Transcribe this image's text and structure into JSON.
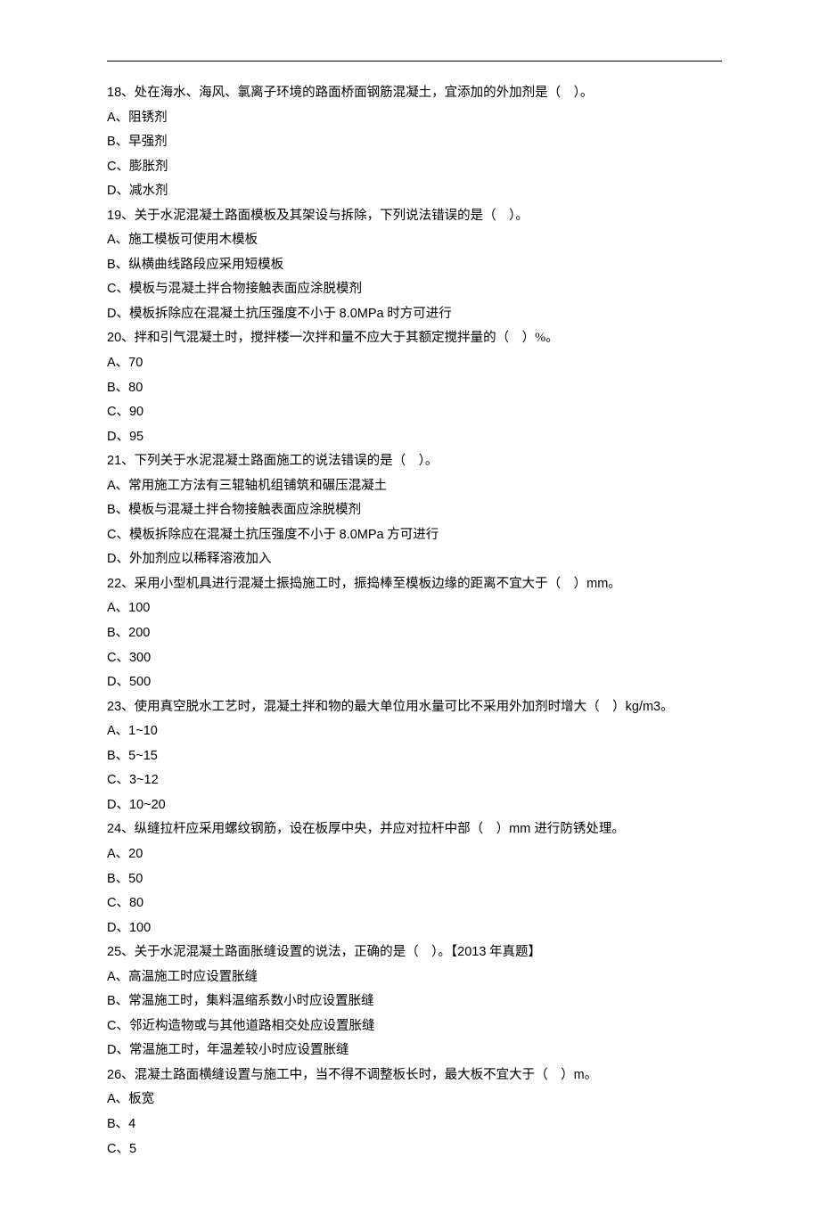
{
  "questions": [
    {
      "num": "18",
      "text": "、处在海水、海风、氯离子环境的路面桥面钢筋混凝土，宜添加的外加剂是（　）。",
      "options": [
        {
          "label": "A",
          "text": "、阻锈剂"
        },
        {
          "label": "B",
          "text": "、早强剂"
        },
        {
          "label": "C",
          "text": "、膨胀剂"
        },
        {
          "label": "D",
          "text": "、减水剂"
        }
      ]
    },
    {
      "num": "19",
      "text": "、关于水泥混凝土路面模板及其架设与拆除，下列说法错误的是（　）。",
      "options": [
        {
          "label": "A",
          "text": "、施工模板可使用木模板"
        },
        {
          "label": "B",
          "text": "、纵横曲线路段应采用短模板"
        },
        {
          "label": "C",
          "text": "、模板与混凝土拌合物接触表面应涂脱模剂"
        },
        {
          "label": "D",
          "text": "、模板拆除应在混凝土抗压强度不小于 8.0MPa 时方可进行",
          "mixed": true,
          "pre": "、模板拆除应在混凝土抗压强度不小于 ",
          "mid": "8.0MPa",
          "post": " 时方可进行"
        }
      ]
    },
    {
      "num": "20",
      "text_pre": "、拌和引气混凝土时，搅拌楼一次拌和量不应大于其额定搅拌量的（　）",
      "text_post": "%。",
      "mixed": true,
      "options": [
        {
          "label": "A",
          "text": "、",
          "num_text": "70"
        },
        {
          "label": "B",
          "text": "、",
          "num_text": "80"
        },
        {
          "label": "C",
          "text": "、",
          "num_text": "90"
        },
        {
          "label": "D",
          "text": "、",
          "num_text": "95"
        }
      ]
    },
    {
      "num": "21",
      "text": "、下列关于水泥混凝土路面施工的说法错误的是（　）。",
      "options": [
        {
          "label": "A",
          "text": "、常用施工方法有三辊轴机组铺筑和碾压混凝土"
        },
        {
          "label": "B",
          "text": "、模板与混凝土拌合物接触表面应涂脱模剂"
        },
        {
          "label": "C",
          "text": "、模板拆除应在混凝土抗压强度不小于 8.0MPa 方可进行",
          "mixed": true,
          "pre": "、模板拆除应在混凝土抗压强度不小于 ",
          "mid": "8.0MPa",
          "post": " 方可进行"
        },
        {
          "label": "D",
          "text": "、外加剂应以稀释溶液加入"
        }
      ]
    },
    {
      "num": "22",
      "text_pre": "、采用小型机具进行混凝土振捣施工时，振捣棒至模板边缘的距离不宜大于（　）",
      "text_post": "mm。",
      "mixed": true,
      "options": [
        {
          "label": "A",
          "text": "、",
          "num_text": "100"
        },
        {
          "label": "B",
          "text": "、",
          "num_text": "200"
        },
        {
          "label": "C",
          "text": "、",
          "num_text": "300"
        },
        {
          "label": "D",
          "text": "、",
          "num_text": "500"
        }
      ]
    },
    {
      "num": "23",
      "text_pre": "、使用真空脱水工艺时，混凝土拌和物的最大单位用水量可比不采用外加剂时增大（　）",
      "text_post": "kg/m3。",
      "mixed": true,
      "options": [
        {
          "label": "A",
          "text": "、",
          "num_text": "1~10"
        },
        {
          "label": "B",
          "text": "、",
          "num_text": "5~15"
        },
        {
          "label": "C",
          "text": "、",
          "num_text": "3~12"
        },
        {
          "label": "D",
          "text": "、",
          "num_text": "10~20"
        }
      ]
    },
    {
      "num": "24",
      "text_pre": "、纵缝拉杆应采用螺纹钢筋，设在板厚中央，并应对拉杆中部（　）",
      "text_post": "mm 进行防锈处理。",
      "mixed": true,
      "options": [
        {
          "label": "A",
          "text": "、",
          "num_text": "20"
        },
        {
          "label": "B",
          "text": "、",
          "num_text": "50"
        },
        {
          "label": "C",
          "text": "、",
          "num_text": "80"
        },
        {
          "label": "D",
          "text": "、",
          "num_text": "100"
        }
      ]
    },
    {
      "num": "25",
      "text_pre": "、关于水泥混凝土路面胀缝设置的说法，正确的是（　）。【",
      "text_post": " 年真题】",
      "mid": "2013",
      "mixed": true,
      "options": [
        {
          "label": "A",
          "text": "、高温施工时应设置胀缝"
        },
        {
          "label": "B",
          "text": "、常温施工时，集料温缩系数小时应设置胀缝"
        },
        {
          "label": "C",
          "text": "、邻近构造物或与其他道路相交处应设置胀缝"
        },
        {
          "label": "D",
          "text": "、常温施工时，年温差较小时应设置胀缝"
        }
      ]
    },
    {
      "num": "26",
      "text_pre": "、混凝土路面横缝设置与施工中，当不得不调整板长时，最大板不宜大于（　）",
      "text_post": "m。",
      "mixed": true,
      "options": [
        {
          "label": "A",
          "text": "、板宽"
        },
        {
          "label": "B",
          "text": "、",
          "num_text": "4"
        },
        {
          "label": "C",
          "text": "、",
          "num_text": "5"
        }
      ]
    }
  ]
}
